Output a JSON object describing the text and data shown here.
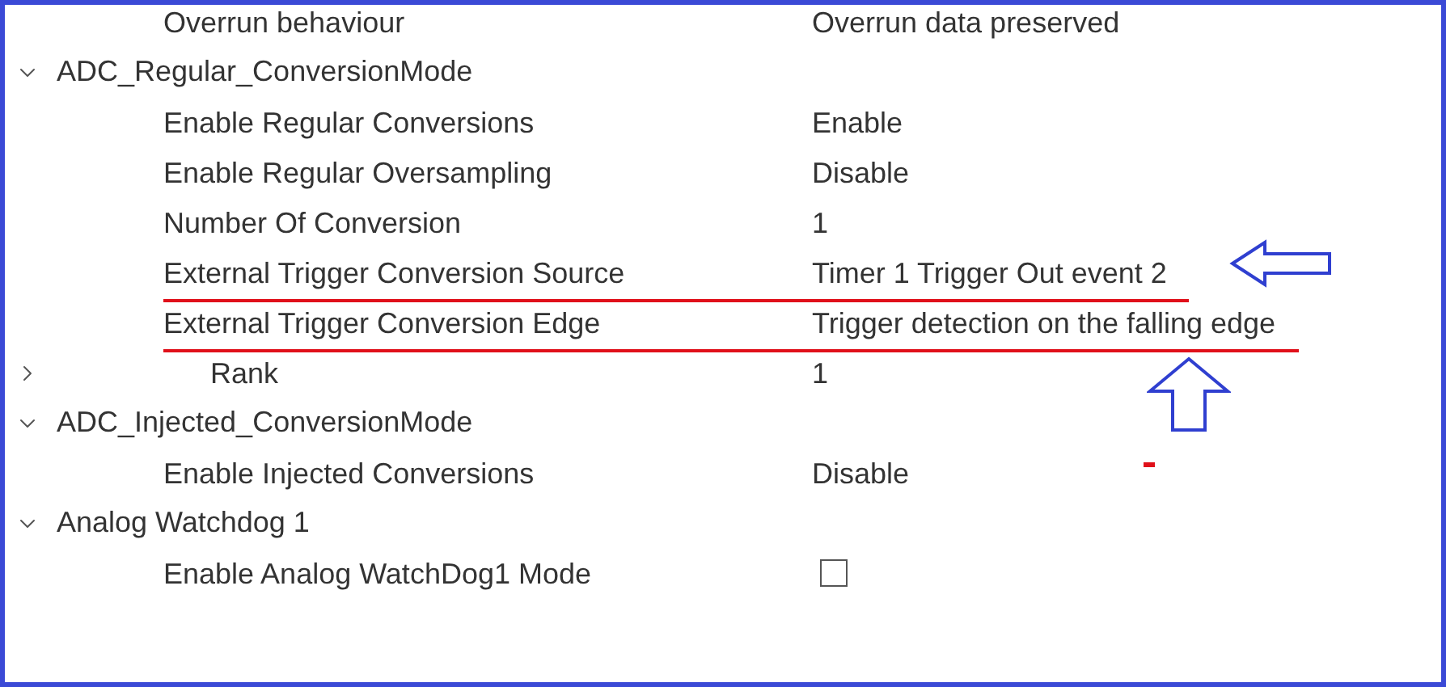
{
  "tree": [
    {
      "kind": "tail",
      "children": [
        {
          "kind": "property",
          "label": "Overrun behaviour",
          "value": "Overrun data preserved"
        }
      ]
    },
    {
      "kind": "group",
      "label": "ADC_Regular_ConversionMode",
      "expanded": true,
      "children": [
        {
          "kind": "property",
          "label": "Enable Regular Conversions",
          "value": "Enable",
          "underlined": false
        },
        {
          "kind": "property",
          "label": "Enable Regular Oversampling",
          "value": "Disable",
          "underlined": false
        },
        {
          "kind": "property",
          "label": "Number Of Conversion",
          "value": "1",
          "underlined": false
        },
        {
          "kind": "property",
          "label": "External Trigger Conversion Source",
          "value": "Timer 1 Trigger Out event 2",
          "underlined": true
        },
        {
          "kind": "property",
          "label": "External Trigger Conversion Edge",
          "value": "Trigger detection on the falling edge",
          "underlined": true
        },
        {
          "kind": "expandable",
          "label": "Rank",
          "value": "1",
          "expanded": false
        }
      ]
    },
    {
      "kind": "group",
      "label": "ADC_Injected_ConversionMode",
      "expanded": true,
      "children": [
        {
          "kind": "property",
          "label": "Enable Injected Conversions",
          "value": "Disable",
          "underlined": false
        }
      ]
    },
    {
      "kind": "group",
      "label": "Analog Watchdog 1",
      "expanded": true,
      "children": [
        {
          "kind": "checkbox",
          "label": "Enable Analog WatchDog1 Mode",
          "checked": false
        }
      ]
    }
  ]
}
